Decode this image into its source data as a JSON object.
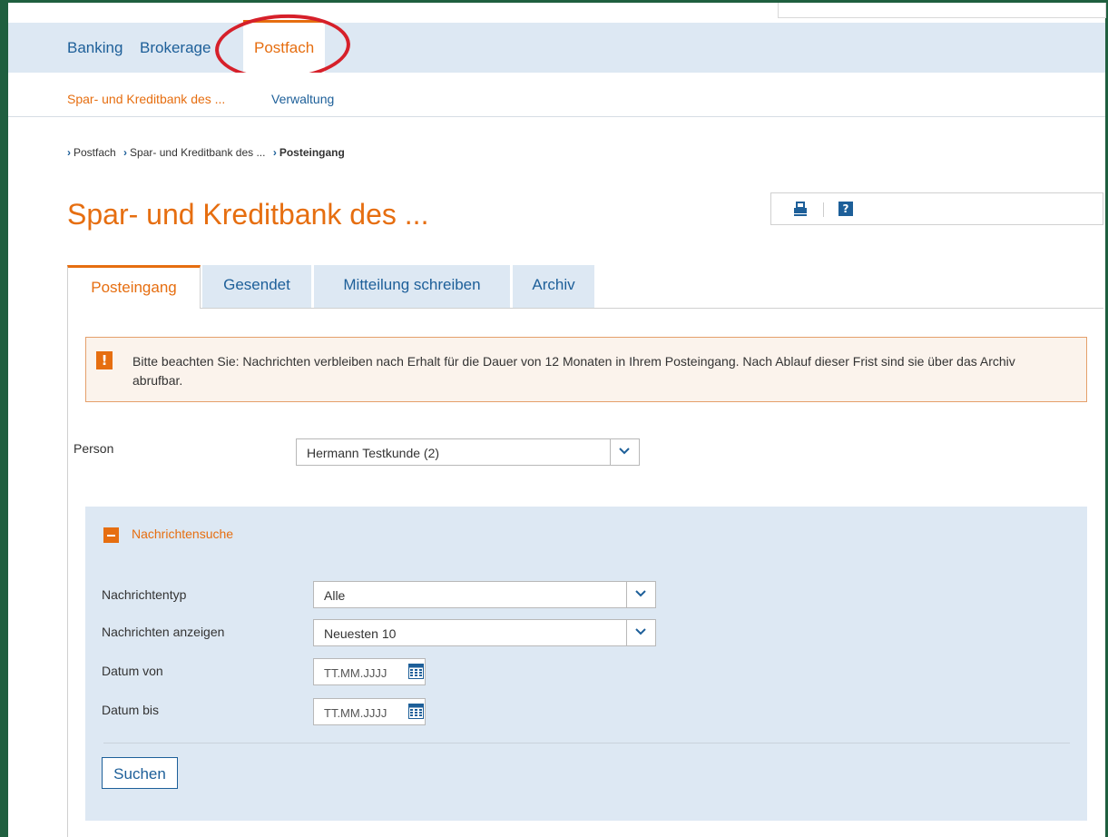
{
  "main_nav": {
    "items": [
      {
        "label": "Banking"
      },
      {
        "label": "Brokerage"
      },
      {
        "label": "Postfach"
      }
    ]
  },
  "sub_nav": {
    "items": [
      {
        "label": "Spar- und Kreditbank des ..."
      },
      {
        "label": "Verwaltung"
      }
    ]
  },
  "breadcrumb": {
    "items": [
      {
        "label": "Postfach"
      },
      {
        "label": "Spar- und Kreditbank des ..."
      },
      {
        "label": "Posteingang"
      }
    ]
  },
  "page": {
    "title": "Spar- und Kreditbank des ..."
  },
  "toolbar": {
    "print_icon": "print-icon",
    "help_label": "?"
  },
  "tabs": [
    {
      "label": "Posteingang"
    },
    {
      "label": "Gesendet"
    },
    {
      "label": "Mitteilung schreiben"
    },
    {
      "label": "Archiv"
    }
  ],
  "notice": {
    "icon": "!",
    "text": "Bitte beachten Sie: Nachrichten verbleiben nach Erhalt für die Dauer von 12 Monaten in Ihrem Posteingang. Nach Ablauf dieser Frist sind sie über das Archiv abrufbar."
  },
  "person": {
    "label": "Person",
    "selected": "Hermann Testkunde (2)"
  },
  "search": {
    "title": "Nachrichtensuche",
    "message_type": {
      "label": "Nachrichtentyp",
      "selected": "Alle"
    },
    "show_messages": {
      "label": "Nachrichten anzeigen",
      "selected": "Neuesten 10"
    },
    "date_from": {
      "label": "Datum von",
      "placeholder": "TT.MM.JJJJ"
    },
    "date_to": {
      "label": "Datum bis",
      "placeholder": "TT.MM.JJJJ"
    },
    "submit_label": "Suchen"
  },
  "colors": {
    "accent_orange": "#e66e10",
    "link_blue": "#1d5f99",
    "nav_bg": "#dde8f3",
    "frame_green": "#1f5f3f",
    "highlight_red": "#d6202a"
  }
}
